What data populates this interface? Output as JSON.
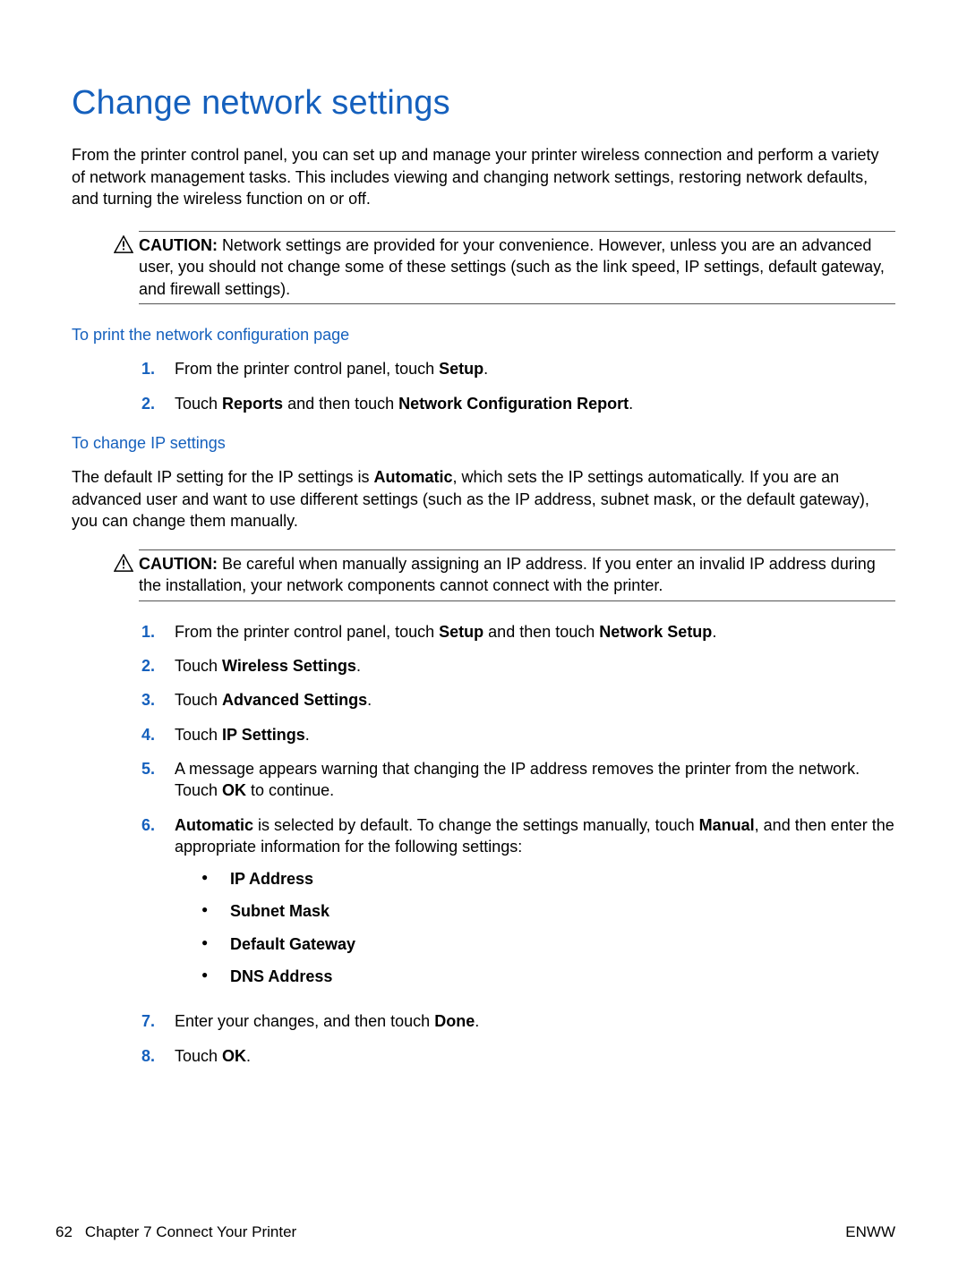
{
  "title": "Change network settings",
  "intro": "From the printer control panel, you can set up and manage your printer wireless connection and perform a variety of network management tasks. This includes viewing and changing network settings, restoring network defaults, and turning the wireless function on or off.",
  "caution1": {
    "label": "CAUTION:",
    "text": "Network settings are provided for your convenience. However, unless you are an advanced user, you should not change some of these settings (such as the link speed, IP settings, default gateway, and firewall settings)."
  },
  "sectionA": {
    "heading": "To print the network configuration page",
    "steps": [
      {
        "num": "1.",
        "pre": "From the printer control panel, touch ",
        "b1": "Setup",
        "post": "."
      },
      {
        "num": "2.",
        "pre": "Touch ",
        "b1": "Reports",
        "mid": " and then touch ",
        "b2": "Network Configuration Report",
        "post": "."
      }
    ]
  },
  "sectionB": {
    "heading": "To change IP settings",
    "intro_pre": "The default IP setting for the IP settings is ",
    "intro_b": "Automatic",
    "intro_post": ", which sets the IP settings automatically. If you are an advanced user and want to use different settings (such as the IP address, subnet mask, or the default gateway), you can change them manually.",
    "caution": {
      "label": "CAUTION:",
      "text": "Be careful when manually assigning an IP address. If you enter an invalid IP address during the installation, your network components cannot connect with the printer."
    },
    "step1": {
      "num": "1.",
      "pre": "From the printer control panel, touch ",
      "b1": "Setup",
      "mid": " and then touch ",
      "b2": "Network Setup",
      "post": "."
    },
    "step2": {
      "num": "2.",
      "pre": "Touch ",
      "b1": "Wireless Settings",
      "post": "."
    },
    "step3": {
      "num": "3.",
      "pre": "Touch ",
      "b1": "Advanced Settings",
      "post": "."
    },
    "step4": {
      "num": "4.",
      "pre": "Touch ",
      "b1": "IP Settings",
      "post": "."
    },
    "step5": {
      "num": "5.",
      "pre": "A message appears warning that changing the IP address removes the printer from the network. Touch ",
      "b1": "OK",
      "post": " to continue."
    },
    "step6": {
      "num": "6.",
      "b1": "Automatic",
      "mid": " is selected by default. To change the settings manually, touch ",
      "b2": "Manual",
      "post": ", and then enter the appropriate information for the following settings:",
      "bullets": [
        "IP Address",
        "Subnet Mask",
        "Default Gateway",
        "DNS Address"
      ]
    },
    "step7": {
      "num": "7.",
      "pre": "Enter your changes, and then touch ",
      "b1": "Done",
      "post": "."
    },
    "step8": {
      "num": "8.",
      "pre": "Touch ",
      "b1": "OK",
      "post": "."
    }
  },
  "footer": {
    "pageNum": "62",
    "chapter": "Chapter 7   Connect Your Printer",
    "right": "ENWW"
  }
}
